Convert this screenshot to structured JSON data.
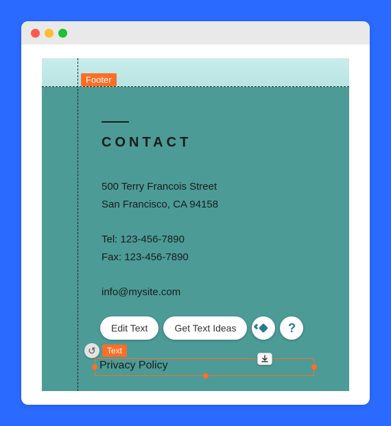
{
  "section_chip": "Footer",
  "element_chip": "Text",
  "contact": {
    "heading": "contact",
    "addr1": "500 Terry Francois Street",
    "addr2": "San Francisco, CA 94158",
    "tel": "Tel: 123-456-7890",
    "fax": "Fax: 123-456-7890",
    "email": "info@mysite.com"
  },
  "toolbar": {
    "edit_text": "Edit Text",
    "get_text_ideas": "Get Text Ideas"
  },
  "selected_text": "Privacy Policy"
}
